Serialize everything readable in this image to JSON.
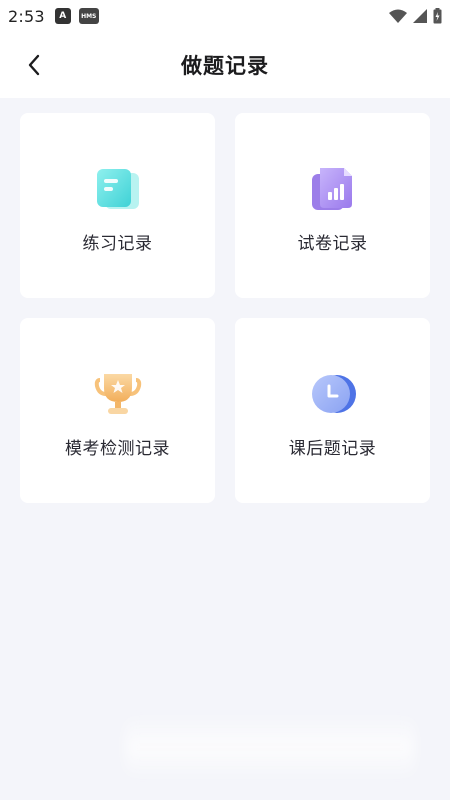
{
  "status_bar": {
    "time": "2:53",
    "app_icon_1": "A",
    "app_icon_2": "HMS",
    "icons": [
      "wifi-icon",
      "cellular-icon",
      "battery-charging-icon"
    ]
  },
  "header": {
    "title": "做题记录",
    "back_icon": "chevron-left-icon"
  },
  "cards": [
    {
      "label": "练习记录",
      "icon": "practice-doc-icon",
      "accent": "#5fe0e0"
    },
    {
      "label": "试卷记录",
      "icon": "exam-chart-icon",
      "accent": "#a98cf0"
    },
    {
      "label": "模考检测记录",
      "icon": "trophy-icon",
      "accent": "#f7c27a"
    },
    {
      "label": "课后题记录",
      "icon": "clock-icon",
      "accent": "#8ca6f5"
    }
  ],
  "colors": {
    "background": "#f4f5fa",
    "card": "#ffffff",
    "title": "#1c1c1e"
  }
}
